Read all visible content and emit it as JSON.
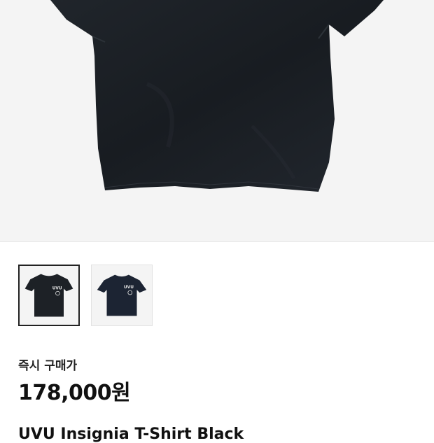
{
  "product": {
    "main_image": "black-tshirt-photo",
    "thumbnails": [
      {
        "name": "thumbnail-1",
        "selected": true,
        "shirt_color": "#1d2126",
        "logo_text": "UVU"
      },
      {
        "name": "thumbnail-2",
        "selected": false,
        "shirt_color": "#1c2433",
        "logo_text": "UVU"
      }
    ],
    "price_label": "즉시 구매가",
    "price": "178,000원",
    "title": "UVU Insignia T-Shirt Black"
  },
  "colors": {
    "hero_background": "#f4f4f4",
    "shirt": "#1b1f24",
    "text": "#111111"
  }
}
